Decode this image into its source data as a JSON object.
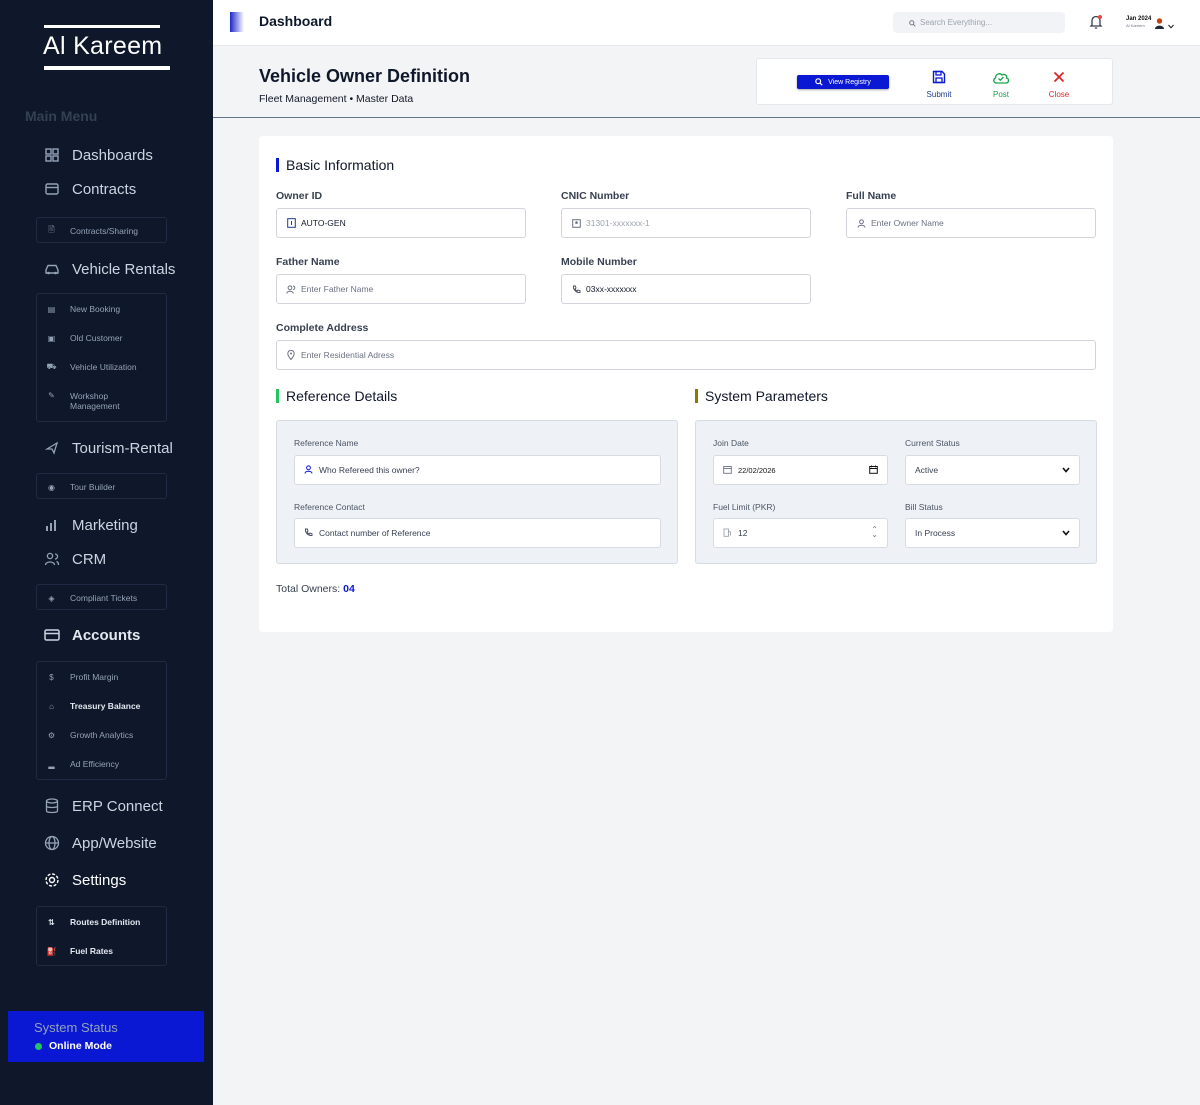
{
  "sidebar": {
    "brand": "Al Kareem",
    "menu_heading": "Main Menu",
    "items": {
      "dashboards": "Dashboards",
      "contracts": "Contracts",
      "contracts_sharing": "Contracts/Sharing",
      "vehicle_rentals": "Vehicle Rentals",
      "new_booking": "New Booking",
      "old_customer": "Old Customer",
      "vehicle_utilization": "Vehicle Utilization",
      "workshop_management_1": "Workshop",
      "workshop_management_2": "Management",
      "tourism_rental": "Tourism-Rental",
      "tour_builder": "Tour Builder",
      "marketing": "Marketing",
      "crm": "CRM",
      "compliant_tickets": "Compliant Tickets",
      "accounts": "Accounts",
      "profit_margin": "Profit Margin",
      "treasury_balance": "Treasury Balance",
      "growth_analytics": "Growth Analytics",
      "ad_efficiency": "Ad Efficiency",
      "erp_connect": "ERP Connect",
      "app_website": "App/Website",
      "settings": "Settings",
      "routes_definition": "Routes Definition",
      "fuel_rates": "Fuel Rates"
    },
    "status": {
      "title": "System Status",
      "mode": "Online Mode"
    }
  },
  "topbar": {
    "title": "Dashboard",
    "search_placeholder": "Search Everything...",
    "user_period": "Jan 2024",
    "user_name": "Al Kareem"
  },
  "header": {
    "title": "Vehicle Owner Definition",
    "breadcrumb": "Fleet Management • Master Data",
    "view_registry": "View Registry",
    "submit": "Submit",
    "post": "Post",
    "close": "Close"
  },
  "basic_info": {
    "title": "Basic Information",
    "owner_id_label": "Owner ID",
    "owner_id_value": "AUTO-GEN",
    "cnic_label": "CNIC Number",
    "cnic_placeholder": "31301-xxxxxxx-1",
    "full_name_label": "Full Name",
    "full_name_placeholder": "Enter Owner Name",
    "father_name_label": "Father Name",
    "father_name_placeholder": "Enter Father Name",
    "mobile_label": "Mobile Number",
    "mobile_value": "03xx-xxxxxxx",
    "address_label": "Complete Address",
    "address_placeholder": "Enter Residential Adress"
  },
  "reference": {
    "title": "Reference Details",
    "name_label": "Reference Name",
    "name_placeholder": "Who Refereed this owner?",
    "contact_label": "Reference Contact",
    "contact_placeholder": "Contact number of Reference"
  },
  "system": {
    "title": "System Parameters",
    "join_date_label": "Join Date",
    "join_date_value": "22/02/2026",
    "status_label": "Current Status",
    "status_value": "Active",
    "fuel_label": "Fuel Limit (PKR)",
    "fuel_value": "12",
    "bill_label": "Bill Status",
    "bill_value": "In Process"
  },
  "footer": {
    "total_label": "Total Owners:",
    "total_value": "04"
  },
  "colors": {
    "sidebar_bg": "#0f172a",
    "primary": "#0a18d4",
    "post_green": "#16a34a",
    "close_red": "#dc2626",
    "reference_accent": "#22c55e",
    "system_accent": "#8a7a00"
  }
}
